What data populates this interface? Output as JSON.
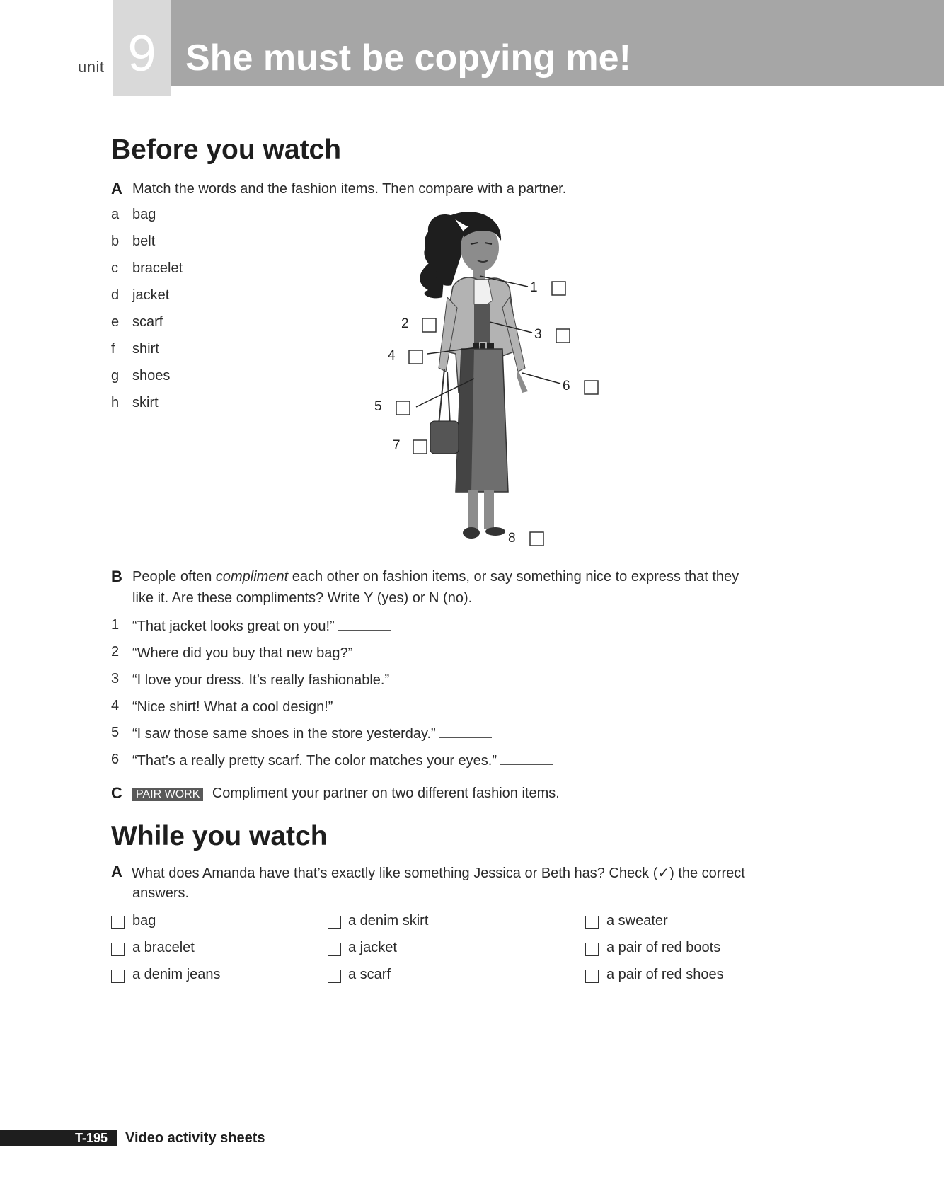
{
  "header": {
    "unit_label": "unit",
    "unit_number": "9",
    "title": "She must be copying me!"
  },
  "section1": {
    "heading": "Before you watch",
    "exA": {
      "letter": "A",
      "instruction": "Match the words and the fashion items. Then compare with a partner.",
      "items": [
        {
          "letter": "a",
          "word": "bag"
        },
        {
          "letter": "b",
          "word": "belt"
        },
        {
          "letter": "c",
          "word": "bracelet"
        },
        {
          "letter": "d",
          "word": "jacket"
        },
        {
          "letter": "e",
          "word": "scarf"
        },
        {
          "letter": "f",
          "word": "shirt"
        },
        {
          "letter": "g",
          "word": "shoes"
        },
        {
          "letter": "h",
          "word": "skirt"
        }
      ],
      "callouts": [
        "1",
        "2",
        "3",
        "4",
        "5",
        "6",
        "7",
        "8"
      ]
    },
    "exB": {
      "letter": "B",
      "instruction_part1": "People often ",
      "instruction_em": "compliment",
      "instruction_part2": " each other on fashion items, or say something nice to express that they",
      "instruction_line2": "like it. Are these compliments? Write Y (yes) or N (no).",
      "items": [
        {
          "num": "1",
          "text": "“That jacket looks great on you!”"
        },
        {
          "num": "2",
          "text": "“Where did you buy that new bag?”"
        },
        {
          "num": "3",
          "text": "“I love your dress. It’s really fashionable.”"
        },
        {
          "num": "4",
          "text": "“Nice shirt! What a cool design!”"
        },
        {
          "num": "5",
          "text": "“I saw those same shoes in the store yesterday.”"
        },
        {
          "num": "6",
          "text": "“That’s a really pretty scarf. The color matches your eyes.”"
        }
      ]
    },
    "exC": {
      "letter": "C",
      "badge": "PAIR WORK",
      "instruction": "Compliment your partner on two different fashion items."
    }
  },
  "section2": {
    "heading": "While you watch",
    "exA": {
      "letter": "A",
      "instruction_line1": "What does Amanda have that’s exactly like something Jessica or Beth has? Check (✓) the correct",
      "instruction_line2": "answers.",
      "columns": [
        [
          "bag",
          "a bracelet",
          "a denim jeans"
        ],
        [
          "a denim skirt",
          "a jacket",
          "a scarf"
        ],
        [
          "a sweater",
          "a pair of red boots",
          "a pair of red shoes"
        ]
      ]
    }
  },
  "footer": {
    "page_code": "T-195",
    "text": "Video activity sheets"
  }
}
